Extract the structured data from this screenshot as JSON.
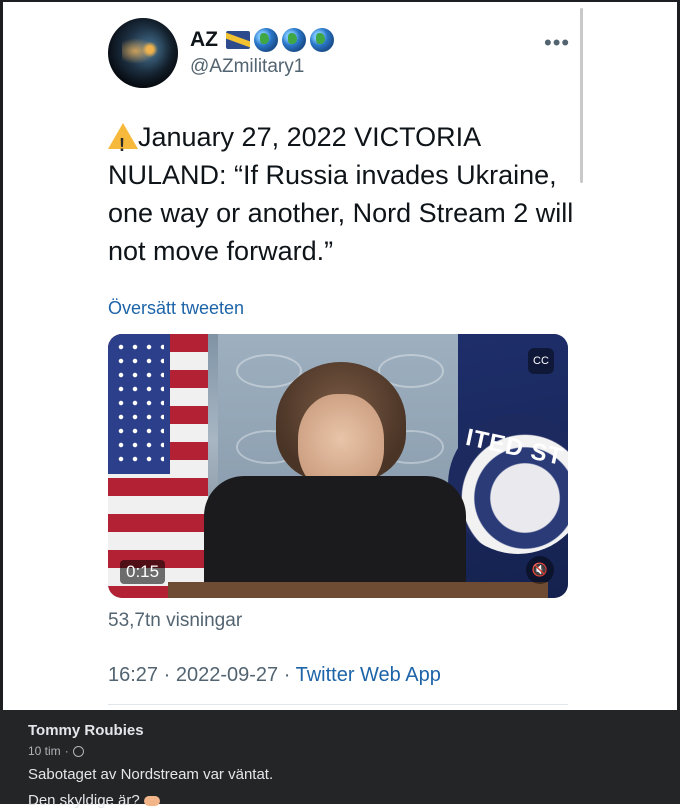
{
  "tweet": {
    "display_name": "AZ",
    "handle": "@AZmilitary1",
    "more_label": "•••",
    "text": "January 27, 2022 VICTORIA NULAND: “If Russia invades Ukraine, one way or another, Nord Stream 2 will not move forward.”",
    "translate_label": "Översätt tweeten",
    "video": {
      "duration": "0:15",
      "seal_text": "ITED ST",
      "cc_label": "CC",
      "mute_label": "🔇"
    },
    "views_count": "53,7tn",
    "views_label": "visningar",
    "time": "16:27",
    "date": "2022-09-27",
    "source_app": "Twitter Web App",
    "separator": " · "
  },
  "comment": {
    "author": "Tommy Roubies",
    "age": "10 tim",
    "age_separator": "·",
    "line1": "Sabotaget av Nordstream var väntat.",
    "line2": "Den skyldige är?"
  },
  "icons": {
    "warning": "warning-icon",
    "flag": "flag-icon",
    "globe": "globe-icon",
    "more": "more-icon",
    "cc": "cc-icon",
    "mute": "mute-icon",
    "privacy": "public-globe-icon",
    "pointing": "pointing-hand-icon"
  },
  "colors": {
    "link": "#1d64a8",
    "secondary_text": "#536471",
    "comment_bg": "#242526"
  }
}
